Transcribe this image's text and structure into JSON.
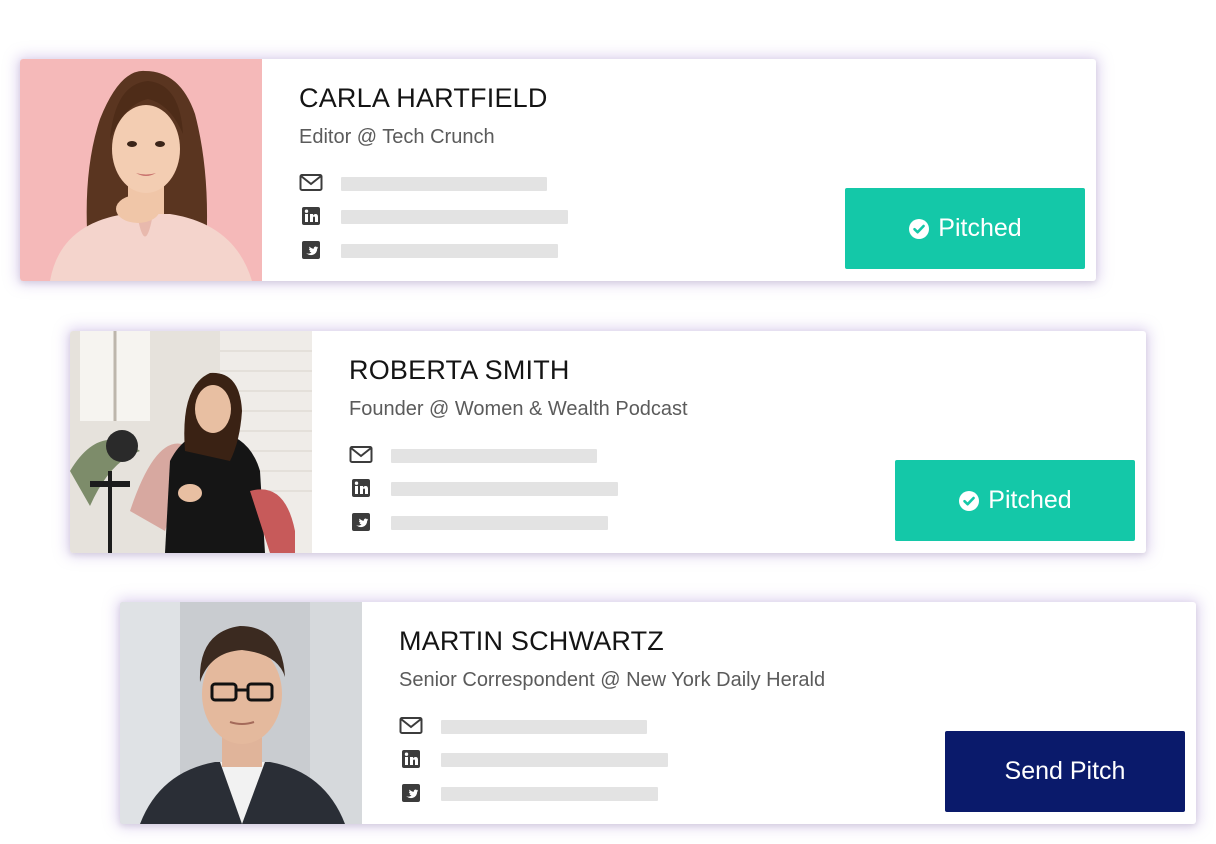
{
  "contacts": [
    {
      "name": "CARLA HARTFIELD",
      "role": "Editor @ Tech Crunch",
      "action_label": "Pitched",
      "action_state": "pitched"
    },
    {
      "name": "ROBERTA SMITH",
      "role": "Founder @ Women & Wealth Podcast",
      "action_label": "Pitched",
      "action_state": "pitched"
    },
    {
      "name": "MARTIN SCHWARTZ",
      "role": "Senior Correspondent @ New York Daily Herald",
      "action_label": "Send Pitch",
      "action_state": "not-pitched"
    }
  ],
  "colors": {
    "pitched": "#14c8a8",
    "send_pitch": "#0a1a6b",
    "placeholder_bar": "#e3e3e3",
    "icon": "#3c3c3c",
    "card_glow": "#a082d2"
  },
  "icons": {
    "email": "envelope-icon",
    "linkedin": "linkedin-icon",
    "twitter": "twitter-icon",
    "pitched": "check-circle-icon"
  }
}
